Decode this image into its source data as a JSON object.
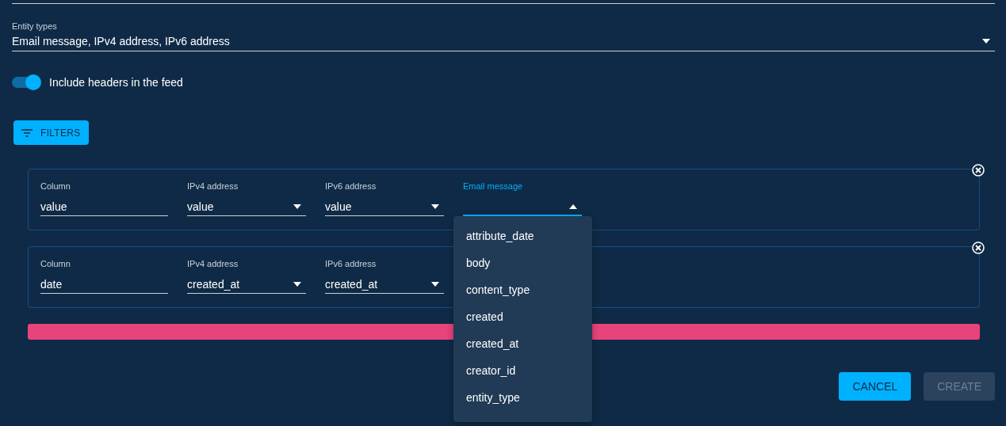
{
  "entity_types": {
    "label": "Entity types",
    "value": "Email message, IPv4 address, IPv6 address"
  },
  "include_headers": {
    "label": "Include headers in the feed",
    "on": true
  },
  "filters_button": {
    "label": "FILTERS"
  },
  "filter_rows": [
    {
      "fields": [
        {
          "kind": "text",
          "label": "Column",
          "value": "value"
        },
        {
          "kind": "select",
          "label": "IPv4 address",
          "value": "value",
          "open": false
        },
        {
          "kind": "select",
          "label": "IPv6 address",
          "value": "value",
          "open": false
        },
        {
          "kind": "select",
          "label": "Email message",
          "open": true
        }
      ]
    },
    {
      "fields": [
        {
          "kind": "text",
          "label": "Column",
          "value": "date"
        },
        {
          "kind": "select",
          "label": "IPv4 address",
          "value": "created_at",
          "open": false
        },
        {
          "kind": "select",
          "label": "IPv6 address",
          "value": "created_at",
          "open": false
        }
      ]
    }
  ],
  "dropdown": {
    "options": [
      "attribute_date",
      "body",
      "content_type",
      "created",
      "created_at",
      "creator_id",
      "entity_type"
    ]
  },
  "buttons": [
    {
      "label": "CANCEL",
      "disabled": false
    },
    {
      "label": "CREATE",
      "disabled": true
    }
  ]
}
